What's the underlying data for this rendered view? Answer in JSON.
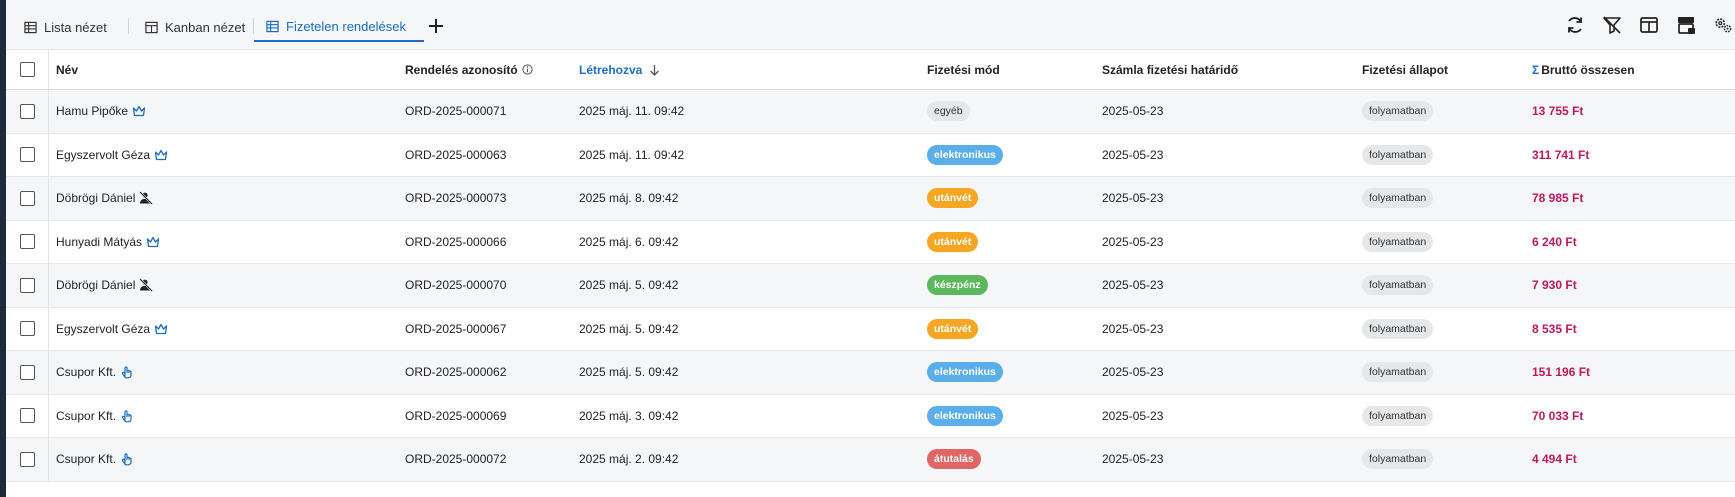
{
  "tabs": [
    {
      "label": "Lista nézet",
      "icon": "table-icon",
      "active": false
    },
    {
      "label": "Kanban nézet",
      "icon": "kanban-icon",
      "active": false
    },
    {
      "label": "Fizetelen rendelések",
      "icon": "table-icon",
      "active": true
    }
  ],
  "toolbar_icons": [
    "refresh-icon",
    "filter-clear-icon",
    "columns-icon",
    "layout-icon",
    "settings-icon"
  ],
  "colors": {
    "accent": "#1b6ec2",
    "total": "#c2185b",
    "egyeb": "#e6e7e9",
    "elektronikus": "#5aaeea",
    "utanvet": "#f5a623",
    "keszpenz": "#5cb85c",
    "atutalas": "#e06666"
  },
  "table": {
    "headers": {
      "name": "Név",
      "id": "Rendelés azonosító",
      "created": "Létrehozva",
      "method": "Fizetési mód",
      "due": "Számla fizetési határidő",
      "status": "Fizetési állapot",
      "total_symbol": "Σ",
      "total": "Bruttó összesen"
    },
    "rows": [
      {
        "name": "Hamu Pipőke",
        "icon": "crown-icon",
        "id": "ORD-2025-000071",
        "created": "2025 máj. 11. 09:42",
        "method": "egyéb",
        "method_color": "#e6e7e9",
        "due": "2025-05-23",
        "status": "folyamatban",
        "total": "13 755 Ft"
      },
      {
        "name": "Egyszervolt Géza",
        "icon": "crown-icon",
        "id": "ORD-2025-000063",
        "created": "2025 máj. 11. 09:42",
        "method": "elektronikus",
        "method_color": "#5aaeea",
        "due": "2025-05-23",
        "status": "folyamatban",
        "total": "311 741 Ft"
      },
      {
        "name": "Döbrögi Dániel",
        "icon": "blocked-user-icon",
        "id": "ORD-2025-000073",
        "created": "2025 máj. 8. 09:42",
        "method": "utánvét",
        "method_color": "#f5a623",
        "due": "2025-05-23",
        "status": "folyamatban",
        "total": "78 985 Ft"
      },
      {
        "name": "Hunyadi Mátyás",
        "icon": "crown-icon",
        "id": "ORD-2025-000066",
        "created": "2025 máj. 6. 09:42",
        "method": "utánvét",
        "method_color": "#f5a623",
        "due": "2025-05-23",
        "status": "folyamatban",
        "total": "6 240 Ft"
      },
      {
        "name": "Döbrögi Dániel",
        "icon": "blocked-user-icon",
        "id": "ORD-2025-000070",
        "created": "2025 máj. 5. 09:42",
        "method": "készpénz",
        "method_color": "#5cb85c",
        "due": "2025-05-23",
        "status": "folyamatban",
        "total": "7 930 Ft"
      },
      {
        "name": "Egyszervolt Géza",
        "icon": "crown-icon",
        "id": "ORD-2025-000067",
        "created": "2025 máj. 5. 09:42",
        "method": "utánvét",
        "method_color": "#f5a623",
        "due": "2025-05-23",
        "status": "folyamatban",
        "total": "8 535 Ft"
      },
      {
        "name": "Csupor Kft.",
        "icon": "pointer-hand-icon",
        "id": "ORD-2025-000062",
        "created": "2025 máj. 5. 09:42",
        "method": "elektronikus",
        "method_color": "#5aaeea",
        "due": "2025-05-23",
        "status": "folyamatban",
        "total": "151 196 Ft"
      },
      {
        "name": "Csupor Kft.",
        "icon": "pointer-hand-icon",
        "id": "ORD-2025-000069",
        "created": "2025 máj. 3. 09:42",
        "method": "elektronikus",
        "method_color": "#5aaeea",
        "due": "2025-05-23",
        "status": "folyamatban",
        "total": "70 033 Ft"
      },
      {
        "name": "Csupor Kft.",
        "icon": "pointer-hand-icon",
        "id": "ORD-2025-000072",
        "created": "2025 máj. 2. 09:42",
        "method": "átutalás",
        "method_color": "#e06666",
        "due": "2025-05-23",
        "status": "folyamatban",
        "total": "4 494 Ft"
      }
    ]
  }
}
